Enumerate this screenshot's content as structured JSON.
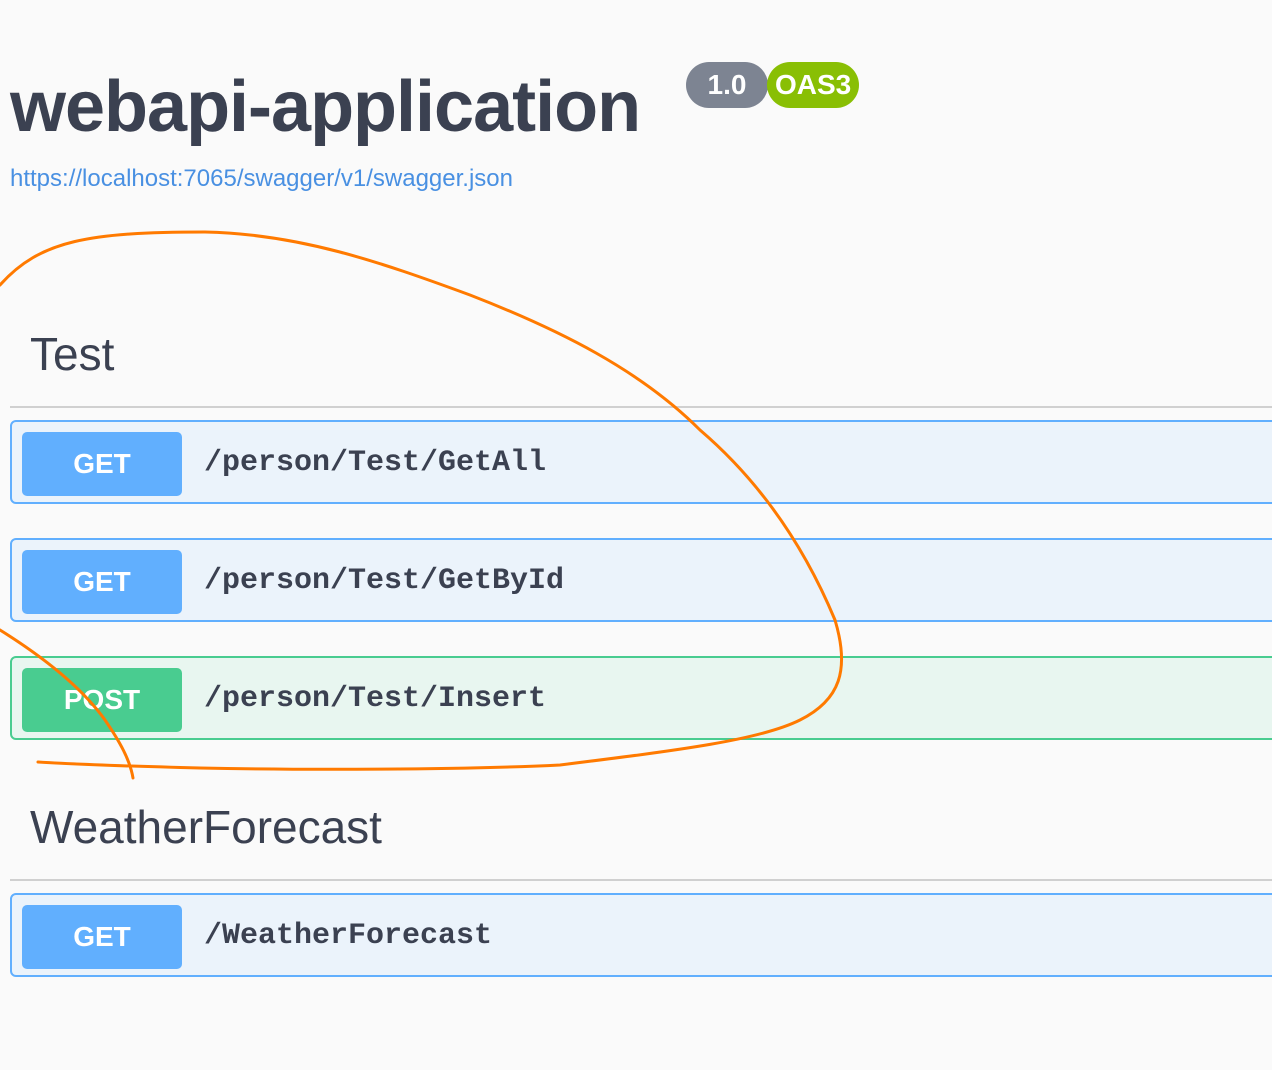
{
  "header": {
    "title": "webapi-application",
    "version_badge": "1.0",
    "spec_badge": "OAS3",
    "spec_link": "https://localhost:7065/swagger/v1/swagger.json"
  },
  "sections": [
    {
      "tag": "Test",
      "operations": [
        {
          "method": "GET",
          "path": "/person/Test/GetAll"
        },
        {
          "method": "GET",
          "path": "/person/Test/GetById"
        },
        {
          "method": "POST",
          "path": "/person/Test/Insert"
        }
      ]
    },
    {
      "tag": "WeatherForecast",
      "operations": [
        {
          "method": "GET",
          "path": "/WeatherForecast"
        }
      ]
    }
  ],
  "colors": {
    "get": "#61affe",
    "post": "#49cc90",
    "version_badge": "#7d8492",
    "spec_badge": "#89bf04",
    "link": "#4990e2",
    "annotation_stroke": "#ff7a00"
  }
}
